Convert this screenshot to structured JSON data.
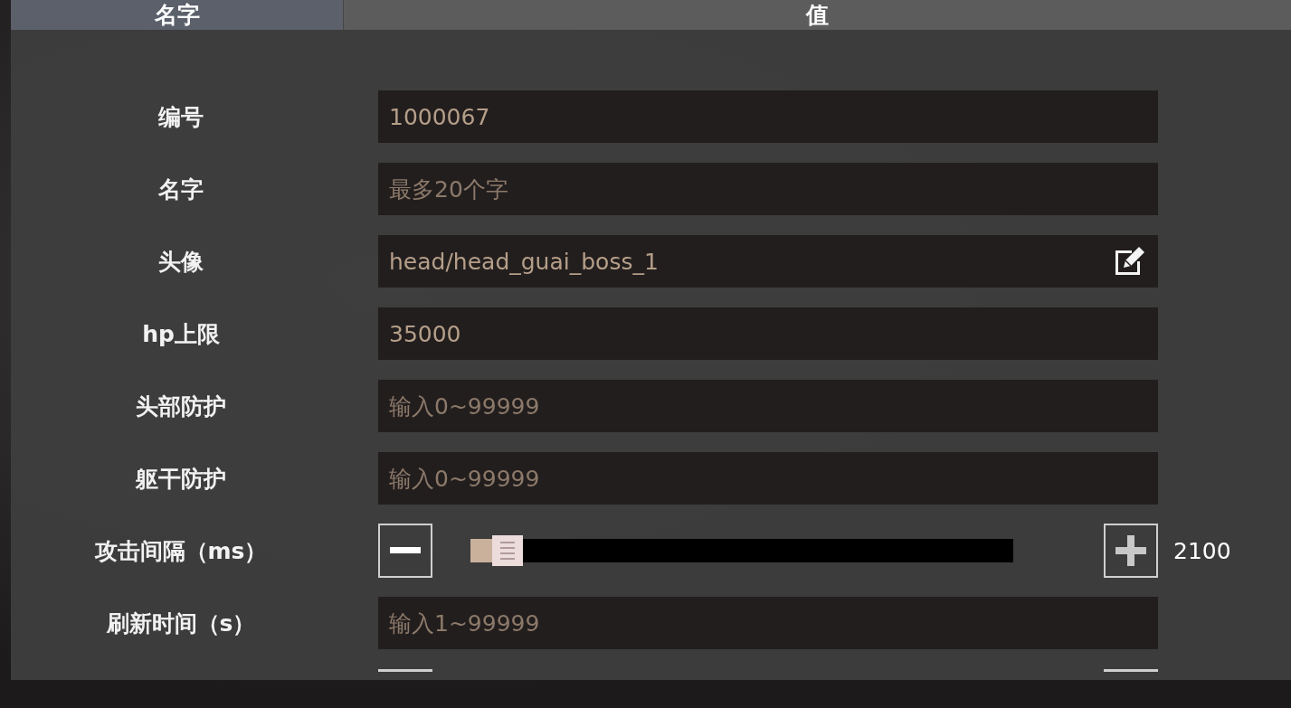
{
  "table": {
    "columns": [
      "名字",
      "值"
    ],
    "rows": [
      {
        "kind": "text",
        "label": "编号",
        "value": "1000067"
      },
      {
        "kind": "text",
        "label": "名字",
        "placeholder": "最多20个字"
      },
      {
        "kind": "text",
        "label": "头像",
        "value": "head/head_guai_boss_1",
        "editable": true
      },
      {
        "kind": "text",
        "label": "hp上限",
        "value": "35000"
      },
      {
        "kind": "text",
        "label": "头部防护",
        "placeholder": "输入0~99999"
      },
      {
        "kind": "text",
        "label": "躯干防护",
        "placeholder": "输入0~99999"
      },
      {
        "kind": "slider",
        "label": "攻击间隔（ms）",
        "level": 0.05,
        "reading": "2100"
      },
      {
        "kind": "text",
        "label": "刷新时间（s）",
        "placeholder": "输入1~99999"
      },
      {
        "kind": "cut"
      }
    ]
  }
}
